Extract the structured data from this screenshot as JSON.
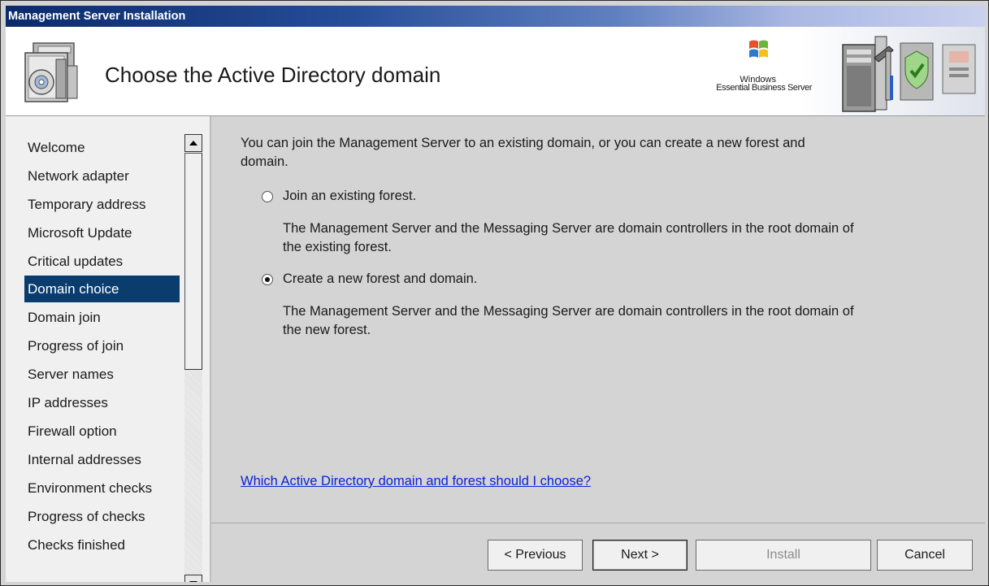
{
  "window": {
    "title": "Management Server Installation"
  },
  "header": {
    "page_title": "Choose the Active Directory domain",
    "brand_line1": "Windows",
    "brand_line2": "Essential Business Server",
    "icon": "setup-package-icon"
  },
  "sidebar": {
    "items": [
      {
        "label": "Welcome"
      },
      {
        "label": "Network adapter"
      },
      {
        "label": "Temporary address"
      },
      {
        "label": "Microsoft Update"
      },
      {
        "label": "Critical updates"
      },
      {
        "label": "Domain choice",
        "selected": true
      },
      {
        "label": "Domain join"
      },
      {
        "label": "Progress of join"
      },
      {
        "label": "Server names"
      },
      {
        "label": "IP addresses"
      },
      {
        "label": "Firewall option"
      },
      {
        "label": "Internal addresses"
      },
      {
        "label": "Environment checks"
      },
      {
        "label": "Progress of checks"
      },
      {
        "label": "Checks finished"
      }
    ],
    "selected_color": "#0a3d6e"
  },
  "content": {
    "intro_line1": "You can join the Management Server to an existing domain, or you can create a new forest and",
    "intro_line2": "domain.",
    "options": [
      {
        "label": "Join an existing forest.",
        "checked": false,
        "desc_line1": "The Management Server and the Messaging Server are domain controllers in the root domain of",
        "desc_line2": "the existing forest."
      },
      {
        "label": "Create a new forest and domain.",
        "checked": true,
        "desc_line1": "The Management Server and the Messaging Server are domain controllers in the root domain of",
        "desc_line2": "the new forest."
      }
    ],
    "help_link": "Which Active Directory domain and forest should I choose?"
  },
  "footer": {
    "previous": "< Previous",
    "next": "Next >",
    "install": "Install",
    "cancel": "Cancel"
  },
  "colors": {
    "link": "#0a22d6",
    "titlebar_start": "#0b2a6b",
    "panel_bg": "#d4d4d4"
  }
}
